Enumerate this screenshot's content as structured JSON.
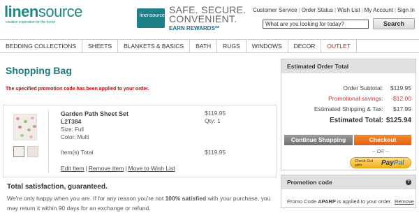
{
  "header": {
    "logo_main": "linen",
    "logo_main2": "source",
    "logo_tag": "creative inspiration for the home",
    "card_text": "linensource",
    "promo_line1": "SAFE. SECURE.",
    "promo_line2": "CONVENIENT.",
    "promo_line3": "EARN REWARDS**",
    "links": [
      "Customer Service",
      "Order Status",
      "Wish List",
      "My Account",
      "Sign In"
    ],
    "search_placeholder": "What are you looking for today?",
    "search_button": "Search"
  },
  "nav": [
    "BEDDING COLLECTIONS",
    "SHEETS",
    "BLANKETS & BASICS",
    "BATH",
    "RUGS",
    "WINDOWS",
    "DECOR",
    "OUTLET"
  ],
  "main": {
    "title": "Shopping Bag",
    "promo_message": "The specified promotion code has been applied to your order.",
    "item": {
      "name": "Garden Path Sheet Set",
      "sku": "L2T384",
      "size": "Size: Full",
      "color": "Color: Multi",
      "price": "$119.95",
      "qty": "Qty: 1",
      "items_total_label": "Item(s) Total",
      "items_total_value": "$119.95",
      "edit_link": "Edit Item",
      "remove_link": "Remove Item",
      "wishlist_link": "Move to Wish List"
    },
    "satisfaction_title": "Total satisfaction, guaranteed.",
    "satisfaction_text_a": "We're only happy when you are. If for any reason you're not ",
    "satisfaction_bold": "100% satisfied",
    "satisfaction_text_b": " with your purchase, you may return it within 90 days for an exchange or refund."
  },
  "order": {
    "title": "Estimated Order Total",
    "subtotal_label": "Order Subtotal:",
    "subtotal_value": "$119.95",
    "savings_label": "Promotional savings:",
    "savings_value": "-$12.00",
    "shipping_label": "Estimated Shipping & Tax:",
    "shipping_value": "$17.99",
    "total_label": "Estimated Total:",
    "total_value": "$125.94",
    "continue_button": "Continue Shopping",
    "checkout_button": "Checkout",
    "or_text": "-- OR --",
    "paypal_check_out": "Check Out",
    "paypal_with": "with",
    "paypal_brand_a": "Pay",
    "paypal_brand_b": "Pal"
  },
  "promo_panel": {
    "title": "Promotion code",
    "text_a": "Promo Code ",
    "code": "APARP",
    "text_b": " is applied to your order.",
    "remove": "Remove"
  },
  "colors": {
    "brand_teal": "#1b7a7a",
    "error_red": "#cc0000",
    "checkout_orange": "#e0601a"
  }
}
